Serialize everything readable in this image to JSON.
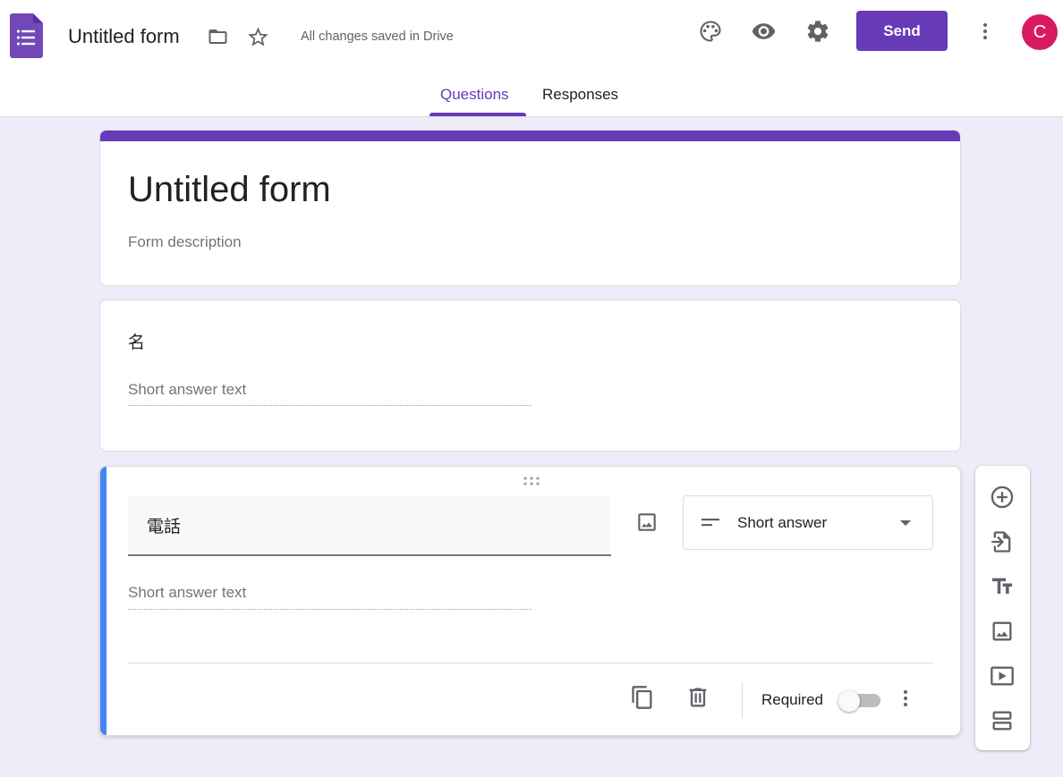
{
  "header": {
    "doc_title": "Untitled form",
    "save_status": "All changes saved in Drive",
    "send_label": "Send",
    "avatar_letter": "C",
    "icons": [
      "forms-logo-icon",
      "folder-icon",
      "star-icon",
      "palette-icon",
      "eye-icon",
      "gear-icon",
      "more-vert-icon"
    ]
  },
  "tabs": [
    {
      "label": "Questions",
      "active": true
    },
    {
      "label": "Responses",
      "active": false
    }
  ],
  "form": {
    "title": "Untitled form",
    "description_placeholder": "Form description"
  },
  "questions": [
    {
      "title": "名",
      "answer_placeholder": "Short answer text"
    },
    {
      "title": "電話",
      "answer_placeholder": "Short answer text",
      "type": "Short answer",
      "required_label": "Required",
      "required": false
    }
  ],
  "side_toolbar": [
    "add-question-icon",
    "import-questions-icon",
    "add-title-icon",
    "add-image-icon",
    "add-video-icon",
    "add-section-icon"
  ],
  "colors": {
    "accent": "#673ab7",
    "background": "#f0ebf8",
    "active_question": "#4285f4",
    "avatar": "#d81b60"
  }
}
